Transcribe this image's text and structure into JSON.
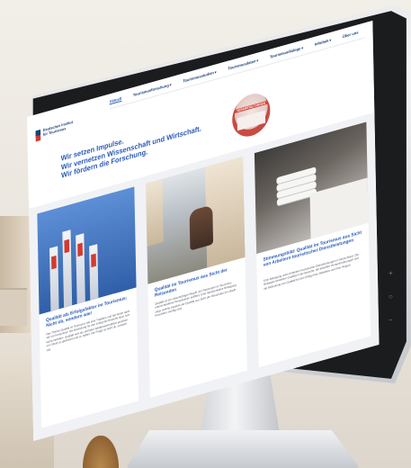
{
  "nav": {
    "logo": "Deutsches Institut für Tourismus",
    "items": [
      {
        "label": "Aktuell",
        "active": true,
        "has_caret": false
      },
      {
        "label": "Tourismusforschung",
        "active": false,
        "has_caret": true
      },
      {
        "label": "Tourismusstudien",
        "active": false,
        "has_caret": true
      },
      {
        "label": "Tourismusdaten",
        "active": false,
        "has_caret": true
      },
      {
        "label": "Tourismusdialoge",
        "active": false,
        "has_caret": true
      },
      {
        "label": "Infothek",
        "active": false,
        "has_caret": true
      },
      {
        "label": "Über uns",
        "active": false,
        "has_caret": false
      }
    ]
  },
  "hero": {
    "tagline": [
      "Wir setzen Impulse.",
      "Wir vernetzen Wissenschaft und Wirtschaft.",
      "Wir fördern die Forschung."
    ],
    "badge": "VERANSTALTUNGEN"
  },
  "cards": [
    {
      "title": "Qualität als Erfolgsfaktor im Tourismus: Nicht ob, sondern wie!",
      "text": "Das Thema Qualität im Tourismus hat eine Tradition und hat heute nach wie vor Konjunktur. Die Bedeutung für den Erfolg der Branche lässt sich leicht herleiten. Qualität wird als zentraler Wettbewerbsfaktor gesehen, um Gäste zu gewinnen und zu halten. Die Frage ist nicht ob, sondern wie."
    },
    {
      "title": "Qualität im Tourismus aus Sicht der Reisenden",
      "text": "Qualität ist ein vielschichtiger Begriff, der Reisenden im Tourismus unterschiedliche Perspektiven eröffnet. Eine repräsentative Befragung zeigt, welche Aspekte der Qualität aus Sicht der Reisenden im Urlaub besonders wichtig sind."
    },
    {
      "title": "Stimmungsbild: Qualität im Tourismus aus Sicht von Arbeitern touristischer Dienstleistungen",
      "text": "Eine Befragung unter Anbietern touristischer Dienstleistungen in Deutschland. Die Befragten bewerten Qualität in der Branche, die aktuellen Herausforderungen und die Bedeutung von Qualität für den Erfolg ihres Betriebes und ihrer Region."
    }
  ],
  "side_controls": [
    "+",
    "○",
    "−"
  ]
}
